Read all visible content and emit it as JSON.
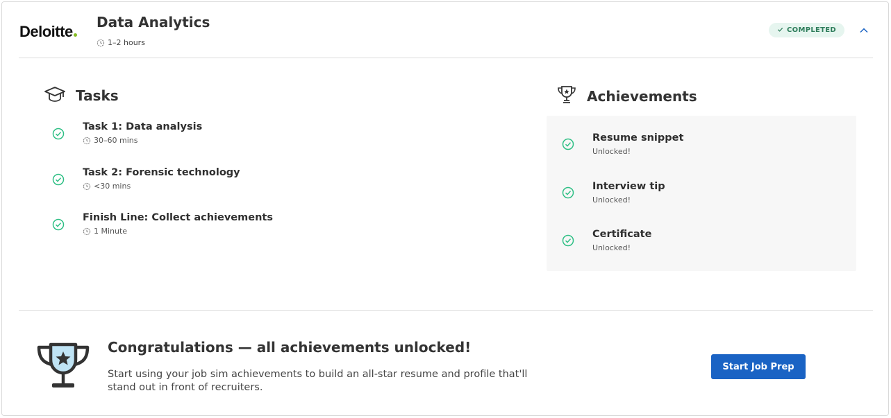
{
  "header": {
    "logo_text": "Deloitte",
    "title": "Data Analytics",
    "duration": "1–2 hours",
    "status": "COMPLETED"
  },
  "tasks": {
    "heading": "Tasks",
    "items": [
      {
        "title": "Task 1: Data analysis",
        "duration": "30–60 mins"
      },
      {
        "title": "Task 2: Forensic technology",
        "duration": "<30 mins"
      },
      {
        "title": "Finish Line: Collect achievements",
        "duration": "1 Minute"
      }
    ]
  },
  "achievements": {
    "heading": "Achievements",
    "items": [
      {
        "title": "Resume snippet",
        "status": "Unlocked!"
      },
      {
        "title": "Interview tip",
        "status": "Unlocked!"
      },
      {
        "title": "Certificate",
        "status": "Unlocked!"
      }
    ]
  },
  "footer": {
    "title": "Congratulations — all achievements unlocked!",
    "text": "Start using your job sim achievements to build an all-star resume and profile that'll stand out in front of recruiters.",
    "button_label": "Start Job Prep"
  },
  "colors": {
    "check_green": "#2fbf85",
    "status_bg": "#e6f5ef",
    "button_blue": "#1a63c4",
    "brand_dot": "#86bc25"
  }
}
